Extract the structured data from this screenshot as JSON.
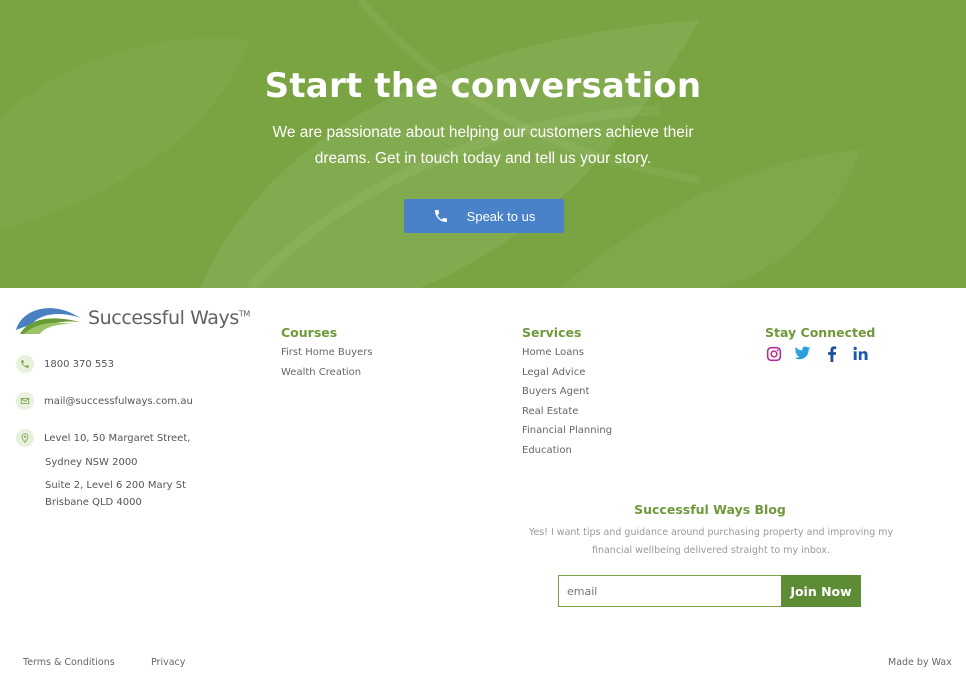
{
  "hero": {
    "title": "Start the conversation",
    "subtitle": "We are passionate about helping our customers achieve their dreams. Get in touch today and tell us your story.",
    "cta_label": "Speak to us",
    "cta_icon": "phone-icon",
    "bg_color": "#79a441",
    "cta_color": "#4a82c9"
  },
  "brand": {
    "name": "Successful Ways",
    "trademark": "TM"
  },
  "contact": {
    "phone": "1800 370 553",
    "email": "mail@successfulways.com.au",
    "address1_line1": "Level 10, 50 Margaret Street,",
    "address1_line2": "Sydney NSW 2000",
    "address2_line1": "Suite 2, Level 6 200 Mary St",
    "address2_line2": "Brisbane QLD 4000"
  },
  "courses": {
    "heading": "Courses",
    "items": [
      "First Home Buyers",
      "Wealth Creation"
    ]
  },
  "services": {
    "heading": "Services",
    "items": [
      "Home Loans",
      "Legal Advice",
      "Buyers Agent",
      "Real Estate",
      "Financial Planning",
      "Education"
    ]
  },
  "social": {
    "heading": "Stay Connected",
    "icons": [
      "instagram-icon",
      "twitter-icon",
      "facebook-icon",
      "linkedin-icon"
    ]
  },
  "blog": {
    "heading": "Successful Ways Blog",
    "text": "Yes! I want tips and guidance around purchasing property and improving my financial wellbeing delivered straight to my inbox.",
    "email_placeholder": "email",
    "join_label": "Join Now",
    "accent": "#6f9a3c"
  },
  "bottom": {
    "terms": "Terms & Conditions",
    "privacy": "Privacy",
    "credit": "Made by Wax"
  }
}
